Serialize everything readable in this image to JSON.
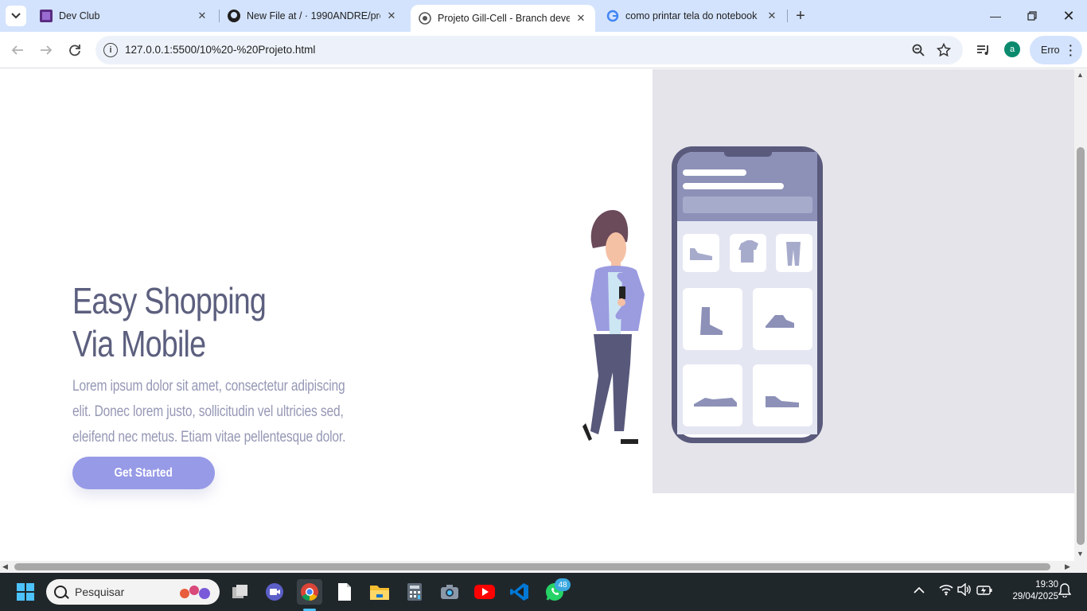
{
  "browser": {
    "tabs": [
      {
        "title": "Dev Club"
      },
      {
        "title": "New File at / · 1990ANDRE/proj"
      },
      {
        "title": "Projeto Gill-Cell - Branch develo"
      },
      {
        "title": "como printar tela do notebook"
      }
    ],
    "url": "127.0.0.1:5500/10%20-%20Projeto.html",
    "profile_initial": "a",
    "error_label": "Erro"
  },
  "page": {
    "title_line1": "Easy Shopping",
    "title_line2": "Via Mobile",
    "description": "Lorem ipsum dolor sit amet, consectetur adipiscing elit. Donec lorem justo, sollicitudin vel ultricies sed, eleifend nec metus. Etiam vitae pellentesque dolor.",
    "cta_label": "Get Started"
  },
  "taskbar": {
    "search_placeholder": "Pesquisar",
    "whatsapp_badge": "48",
    "time": "19:30",
    "date": "29/04/2025"
  },
  "colors": {
    "accent": "#979ae6",
    "title": "#5c5f7e",
    "panel": "#e4e4ea",
    "tab_strip": "#d3e3fd"
  }
}
